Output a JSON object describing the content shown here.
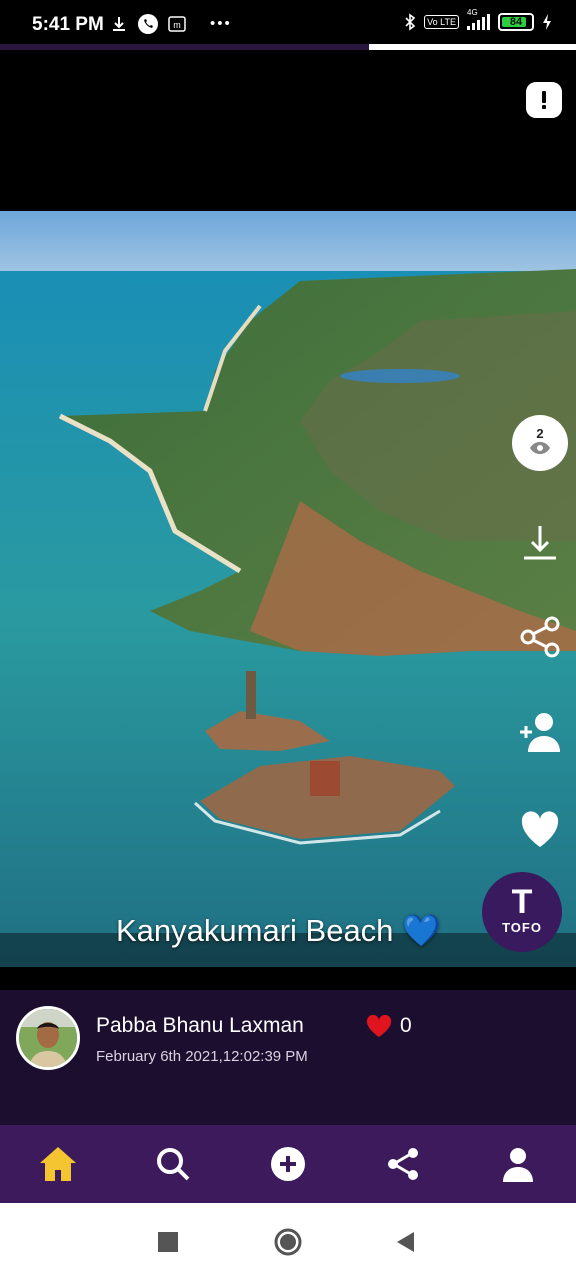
{
  "status_bar": {
    "time": "5:41 PM",
    "network_label": "4G",
    "volte_label": "Vo LTE",
    "battery": "84",
    "battery_level": 0.84,
    "icons": [
      "download-icon",
      "phone-icon",
      "m-badge-icon",
      "more-dots-icon",
      "bluetooth-icon",
      "volte-icon",
      "signal-icon",
      "battery-icon",
      "charging-icon"
    ]
  },
  "story_progress": 0.36,
  "post": {
    "caption": "Kanyakumari Beach 💙",
    "views": "2",
    "user_name": "Pabba Bhanu Laxman",
    "likes": "0",
    "date": "February 6th 2021,12:02:39 PM",
    "brand_logo": "TOFO"
  },
  "side_actions": [
    "views-icon",
    "download-icon",
    "share-icon",
    "follow-icon",
    "like-icon"
  ],
  "bottom_nav": [
    {
      "name": "home",
      "icon": "home-icon",
      "active": true
    },
    {
      "name": "search",
      "icon": "search-icon",
      "active": false
    },
    {
      "name": "create",
      "icon": "add-icon",
      "active": false
    },
    {
      "name": "share",
      "icon": "share-icon",
      "active": false
    },
    {
      "name": "profile",
      "icon": "profile-icon",
      "active": false
    }
  ],
  "colors": {
    "nav_bg": "#3d1a5c",
    "panel_bg": "#1c0e2e",
    "active_nav": "#f4c531",
    "heart": "#e0141e"
  }
}
